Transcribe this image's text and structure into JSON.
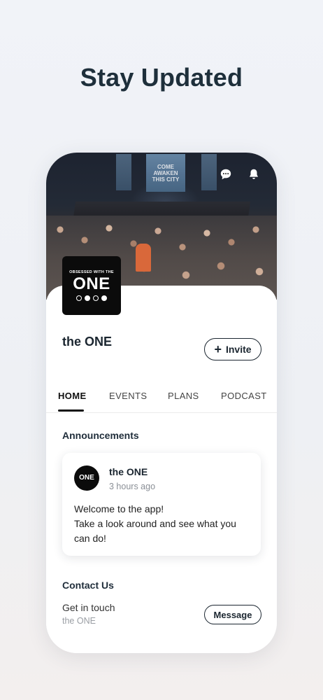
{
  "headline": "Stay Updated",
  "hero": {
    "screen_text": "COME AWAKEN THIS CITY",
    "chat_icon": "chat-bubble-icon",
    "bell_icon": "bell-icon"
  },
  "group": {
    "logo_sub": "OBSESSED WITH THE",
    "logo_main": "ONE",
    "name": "the ONE",
    "invite_label": "Invite",
    "invite_icon": "+"
  },
  "tabs": [
    {
      "label": "HOME",
      "active": true
    },
    {
      "label": "EVENTS",
      "active": false
    },
    {
      "label": "PLANS",
      "active": false
    },
    {
      "label": "PODCAST",
      "active": false
    }
  ],
  "announcements": {
    "title": "Announcements",
    "post": {
      "avatar_text": "ONE",
      "author": "the ONE",
      "time": "3 hours ago",
      "body_lines": [
        "Welcome to the app!",
        "Take a look around and see what you",
        "can do!"
      ]
    }
  },
  "contact": {
    "title": "Contact Us",
    "line": "Get in touch",
    "sub": "the ONE",
    "button_label": "Message"
  },
  "colors": {
    "headline": "#1e2f3b",
    "text_dark": "#1b2630",
    "muted": "#8a8f96",
    "logo_bg": "#0b0b0b"
  }
}
